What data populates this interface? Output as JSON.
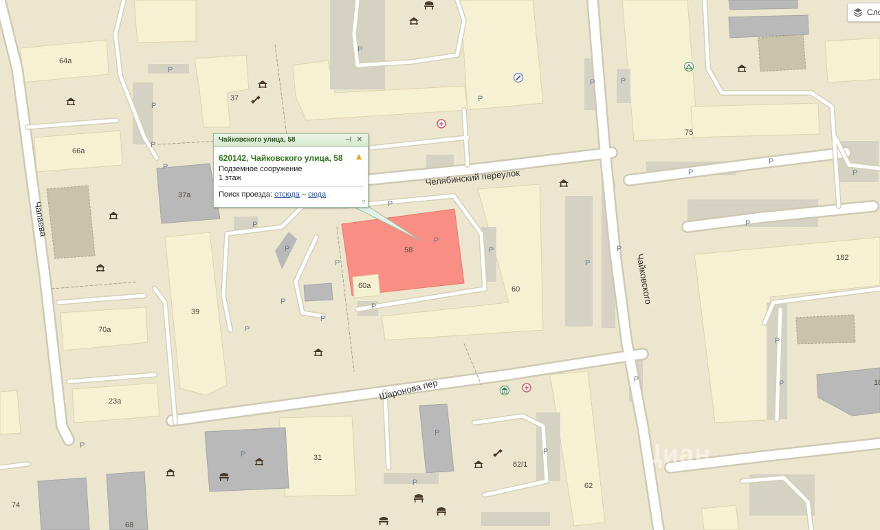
{
  "popup": {
    "title": "Чайковского улица, 58",
    "pin_symbol": "⊣",
    "close_symbol": "✕",
    "address": "620142, Чайковского улица, 58",
    "type": "Подземное сооружение",
    "floors": "1 этаж",
    "route_label": "Поиск проезда:",
    "route_from": "отсюда",
    "route_dash": "–",
    "route_to": "сюда",
    "grip": "⠿"
  },
  "layers_button": {
    "label": "Сло",
    "icon": "layers-icon"
  },
  "streets": {
    "chelyabinsky": "Челябинский переулок",
    "sharonova": "Шаронова пер",
    "chaikovskogo": "Чайковского",
    "chapaeva": "Чапаева"
  },
  "buildings": {
    "b64a": "64а",
    "b37": "37",
    "b66a": "66а",
    "b37a": "37а",
    "b39": "39",
    "b70a": "70а",
    "b23a": "23а",
    "b58": "58",
    "b60a": "60а",
    "b60": "60",
    "b75": "75",
    "b182": "182",
    "b31": "31",
    "b62_1": "62/1",
    "b62": "62",
    "b74": "74",
    "b68": "68",
    "b18": "18"
  },
  "parking_letter": "P",
  "watermark": "Циан",
  "colors": {
    "background": "#ede6cf",
    "building": "#f7f1d3",
    "building_gray": "#b7b7b7",
    "highlight": "#f98f84",
    "road": "#ffffff",
    "road_border": "#cfc9b3",
    "popup_title": "#2e7a1a",
    "link": "#2a5db0"
  }
}
